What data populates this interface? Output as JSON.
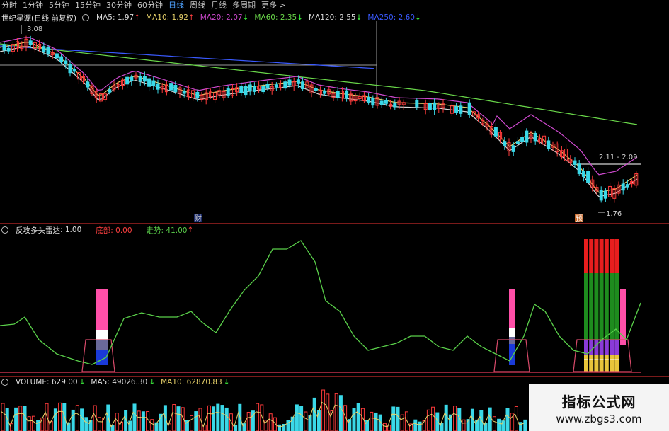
{
  "tabs": [
    "分时",
    "1分钟",
    "5分钟",
    "15分钟",
    "30分钟",
    "60分钟",
    "日线",
    "周线",
    "月线",
    "多周期",
    "更多 >"
  ],
  "active_tab_index": 6,
  "main_legend": {
    "title": "世纪星源(日线 前复权)",
    "items": [
      {
        "text": "MA5: 1.97",
        "color": "#d8d8d8",
        "trend": "up"
      },
      {
        "text": "MA10: 1.92",
        "color": "#e8d26a",
        "trend": "up"
      },
      {
        "text": "MA20: 2.07",
        "color": "#d04ad0",
        "trend": "down"
      },
      {
        "text": "MA60: 2.35",
        "color": "#6ad84a",
        "trend": "down"
      },
      {
        "text": "MA120: 2.55",
        "color": "#d8d8d8",
        "trend": "down"
      },
      {
        "text": "MA250: 2.60",
        "color": "#3a5aff",
        "trend": "down"
      }
    ]
  },
  "price_annotations": {
    "high": "3.08",
    "low": "1.76",
    "range": "2.11 - 2.09",
    "marker_cai": "财",
    "marker_yu": "预"
  },
  "indicator_legend": {
    "title": "反攻多头雷达",
    "value": ": 1.00",
    "bottom_label": "底部: 0.00",
    "trend_label": "走势: 41.00",
    "trend_arrow": "up"
  },
  "volume_legend": {
    "title": "VOLUME: 629.00",
    "ma5": "MA5: 49026.30",
    "ma10": "MA10: 62870.83"
  },
  "watermark": {
    "title": "指标公式网",
    "url": "www.zbgs3.com"
  },
  "colors": {
    "up_candle": "#ff3b3b",
    "down_candle": "#3ad8e8",
    "trend_line": "#5ad04a",
    "bottom_bar_pink": "#ff4fa8",
    "indicator_red": "#e81e1e",
    "indicator_green": "#1e8c1e",
    "indicator_purple": "#8a3ad8",
    "indicator_yellow": "#e8c43a"
  }
}
